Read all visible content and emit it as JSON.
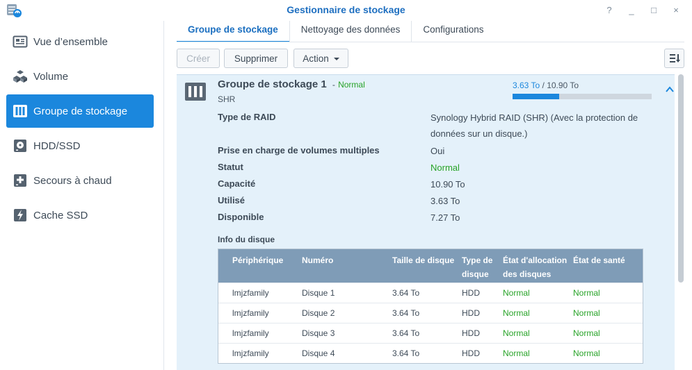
{
  "window": {
    "title": "Gestionnaire de stockage",
    "controls": [
      "?",
      "_",
      "□",
      "×"
    ]
  },
  "sidebar": {
    "items": [
      {
        "label": "Vue d’ensemble",
        "icon": "overview-icon",
        "active": false
      },
      {
        "label": "Volume",
        "icon": "cubes-icon",
        "active": false
      },
      {
        "label": "Groupe de stockage",
        "icon": "storage-pool-icon",
        "active": true
      },
      {
        "label": "HDD/SSD",
        "icon": "disk-icon",
        "active": false
      },
      {
        "label": "Secours à chaud",
        "icon": "hot-spare-plus-icon",
        "active": false
      },
      {
        "label": "Cache SSD",
        "icon": "lightning-drive-icon",
        "active": false
      }
    ]
  },
  "tabs": [
    {
      "label": "Groupe de stockage",
      "active": true
    },
    {
      "label": "Nettoyage des données",
      "active": false
    },
    {
      "label": "Configurations",
      "active": false
    }
  ],
  "toolbar": {
    "create": "Créer",
    "delete": "Supprimer",
    "action": "Action"
  },
  "pool": {
    "name": "Groupe de stockage 1",
    "separator": "-",
    "status": "Normal",
    "type": "SHR",
    "used": "3.63 To",
    "slash": "/",
    "total": "10.90 To",
    "usage_fraction": 0.333,
    "accent_color": "#1b87dd",
    "status_color": "#27a327"
  },
  "properties": [
    {
      "label": "Type de RAID",
      "value": "Synology Hybrid RAID (SHR) (Avec la protection de données sur un disque.)"
    },
    {
      "label": "Prise en charge de volumes multiples",
      "value": "Oui"
    },
    {
      "label": "Statut",
      "value": "Normal",
      "green": true
    },
    {
      "label": "Capacité",
      "value": "10.90 To"
    },
    {
      "label": "Utilisé",
      "value": "3.63 To"
    },
    {
      "label": "Disponible",
      "value": "7.27 To"
    }
  ],
  "disk_info": {
    "title": "Info du disque",
    "headers": [
      "Périphérique",
      "Numéro",
      "Taille de disque",
      "Type de disque",
      "État d'allocation des disques",
      "État de santé"
    ],
    "rows": [
      [
        "lmjzfamily",
        "Disque 1",
        "3.64 To",
        "HDD",
        "Normal",
        "Normal"
      ],
      [
        "lmjzfamily",
        "Disque 2",
        "3.64 To",
        "HDD",
        "Normal",
        "Normal"
      ],
      [
        "lmjzfamily",
        "Disque 3",
        "3.64 To",
        "HDD",
        "Normal",
        "Normal"
      ],
      [
        "lmjzfamily",
        "Disque 4",
        "3.64 To",
        "HDD",
        "Normal",
        "Normal"
      ]
    ]
  }
}
